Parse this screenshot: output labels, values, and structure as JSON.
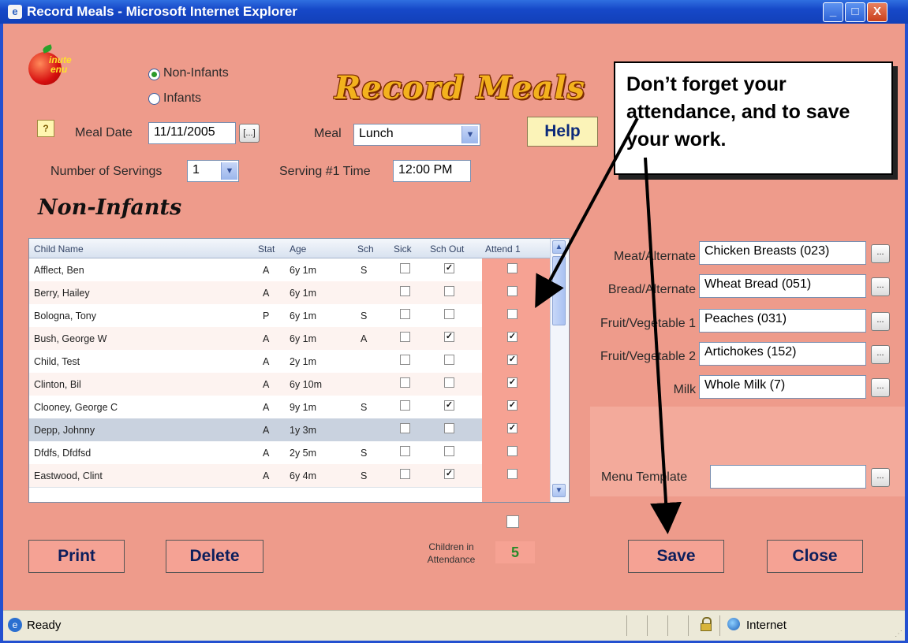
{
  "window": {
    "title": "Record Meals - Microsoft Internet Explorer",
    "min": "_",
    "max": "□",
    "close": "X"
  },
  "logo": {
    "text_line1": "inute",
    "text_line2": "enu"
  },
  "mode": {
    "option1": "Non-Infants",
    "option2": "Infants",
    "selected": "Non-Infants"
  },
  "page_title": "Record Meals",
  "section_title": "Non-Infants",
  "help_q": "?",
  "meal_date": {
    "label": "Meal Date",
    "value": "11/11/2005",
    "picker": "[...]"
  },
  "meal": {
    "label": "Meal",
    "value": "Lunch"
  },
  "help_label": "Help",
  "servings": {
    "label": "Number of Servings",
    "value": "1"
  },
  "serving_time": {
    "label": "Serving #1 Time",
    "value": "12:00 PM"
  },
  "grid": {
    "headers": [
      "Child Name",
      "Stat",
      "Age",
      "Sch",
      "Sick",
      "Sch Out",
      "Attend 1"
    ],
    "rows": [
      {
        "name": "Afflect, Ben",
        "stat": "A",
        "age": "6y 1m",
        "sch": "S",
        "sick": false,
        "schout": true,
        "attend": false
      },
      {
        "name": "Berry, Hailey",
        "stat": "A",
        "age": "6y 1m",
        "sch": "",
        "sick": false,
        "schout": false,
        "attend": false
      },
      {
        "name": "Bologna, Tony",
        "stat": "P",
        "age": "6y 1m",
        "sch": "S",
        "sick": false,
        "schout": false,
        "attend": false
      },
      {
        "name": "Bush, George W",
        "stat": "A",
        "age": "6y 1m",
        "sch": "A",
        "sick": false,
        "schout": true,
        "attend": true
      },
      {
        "name": "Child, Test",
        "stat": "A",
        "age": "2y 1m",
        "sch": "",
        "sick": false,
        "schout": false,
        "attend": true
      },
      {
        "name": "Clinton, Bil",
        "stat": "A",
        "age": "6y 10m",
        "sch": "",
        "sick": false,
        "schout": false,
        "attend": true
      },
      {
        "name": "Clooney, George C",
        "stat": "A",
        "age": "9y 1m",
        "sch": "S",
        "sick": false,
        "schout": true,
        "attend": true
      },
      {
        "name": "Depp, Johnny",
        "stat": "A",
        "age": "1y 3m",
        "sch": "",
        "sick": false,
        "schout": false,
        "attend": true
      },
      {
        "name": "Dfdfs, Dfdfsd",
        "stat": "A",
        "age": "2y 5m",
        "sch": "S",
        "sick": false,
        "schout": false,
        "attend": false
      },
      {
        "name": "Eastwood, Clint",
        "stat": "A",
        "age": "6y 4m",
        "sch": "S",
        "sick": false,
        "schout": true,
        "attend": false
      }
    ],
    "selected_row": 7
  },
  "food": {
    "meat_label": "Meat/Alternate",
    "meat_value": "Chicken Breasts (023)",
    "bread_label": "Bread/Alternate",
    "bread_value": "Wheat Bread (051)",
    "fv1_label": "Fruit/Vegetable 1",
    "fv1_value": "Peaches (031)",
    "fv2_label": "Fruit/Vegetable 2",
    "fv2_value": "Artichokes (152)",
    "milk_label": "Milk",
    "milk_value": "Whole Milk (7)",
    "lookup": "..."
  },
  "template": {
    "label": "Menu Template",
    "value": ""
  },
  "buttons": {
    "print": "Print",
    "delete": "Delete",
    "save": "Save",
    "close": "Close"
  },
  "attendance": {
    "label1": "Children in",
    "label2": "Attendance",
    "count": "5"
  },
  "callout": {
    "text": "Don’t forget your attendance, and to save your work."
  },
  "statusbar": {
    "ready": "Ready",
    "zone": "Internet"
  },
  "colors": {
    "client_bg": "#ee9b8b",
    "title_bar": "#1648c8",
    "attend_col": "#f6a293"
  }
}
